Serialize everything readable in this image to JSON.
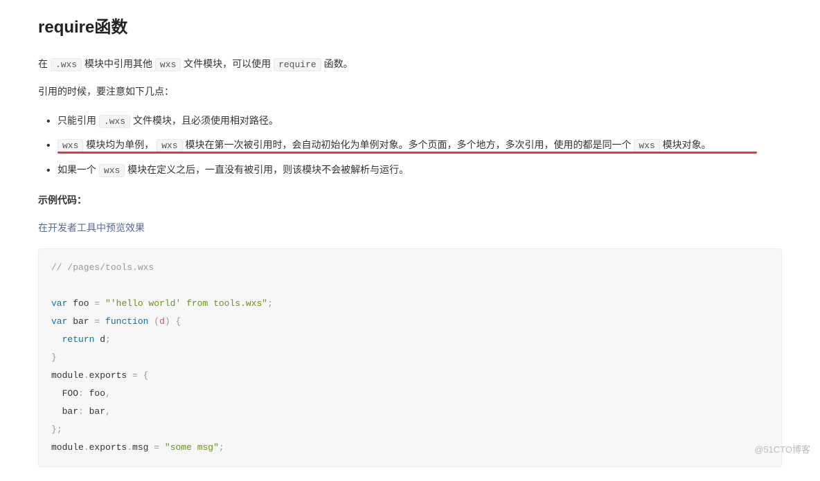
{
  "heading": "require函数",
  "intro": {
    "pre": "在 ",
    "code1": ".wxs",
    "mid1": " 模块中引用其他 ",
    "code2": "wxs",
    "mid2": " 文件模块，可以使用 ",
    "code3": "require",
    "post": " 函数。"
  },
  "noteIntro": "引用的时候，要注意如下几点：",
  "bullets": {
    "b1": {
      "pre": "只能引用 ",
      "code": ".wxs",
      "post": " 文件模块，且必须使用相对路径。"
    },
    "b2": {
      "code1": "wxs",
      "t1": " 模块均为单例， ",
      "code2": "wxs",
      "t2": " 模块在第一次被引用时，会自动初始化为单例对象。多个页面，多个地方，多次引用，使用的都是同一个 ",
      "code3": "wxs",
      "t3": " 模块对象。"
    },
    "b3": {
      "pre": "如果一个 ",
      "code": "wxs",
      "post": " 模块在定义之后，一直没有被引用，则该模块不会被解析与运行。"
    }
  },
  "sampleLabel": "示例代码：",
  "previewLink": "在开发者工具中预览效果",
  "code": {
    "c1": "// /pages/tools.wxs",
    "l1a": "var",
    "l1b": " foo ",
    "l1c": "=",
    "l1d": " ",
    "l1e": "\"'hello world' from tools.wxs\"",
    "l1f": ";",
    "l2a": "var",
    "l2b": " bar ",
    "l2c": "=",
    "l2d": " ",
    "l2e": "function",
    "l2f": " ",
    "l2g": "(",
    "l2h": "d",
    "l2i": ")",
    "l2j": " ",
    "l2k": "{",
    "l3a": "  ",
    "l3b": "return",
    "l3c": " d",
    "l3d": ";",
    "l4a": "}",
    "l5a": "module",
    "l5b": ".",
    "l5c": "exports ",
    "l5d": "=",
    "l5e": " ",
    "l5f": "{",
    "l6a": "  FOO",
    "l6b": ":",
    "l6c": " foo",
    "l6d": ",",
    "l7a": "  bar",
    "l7b": ":",
    "l7c": " bar",
    "l7d": ",",
    "l8a": "}",
    "l8b": ";",
    "l9a": "module",
    "l9b": ".",
    "l9c": "exports",
    "l9d": ".",
    "l9e": "msg ",
    "l9f": "=",
    "l9g": " ",
    "l9h": "\"some msg\"",
    "l9i": ";"
  },
  "watermark": "@51CTO博客"
}
